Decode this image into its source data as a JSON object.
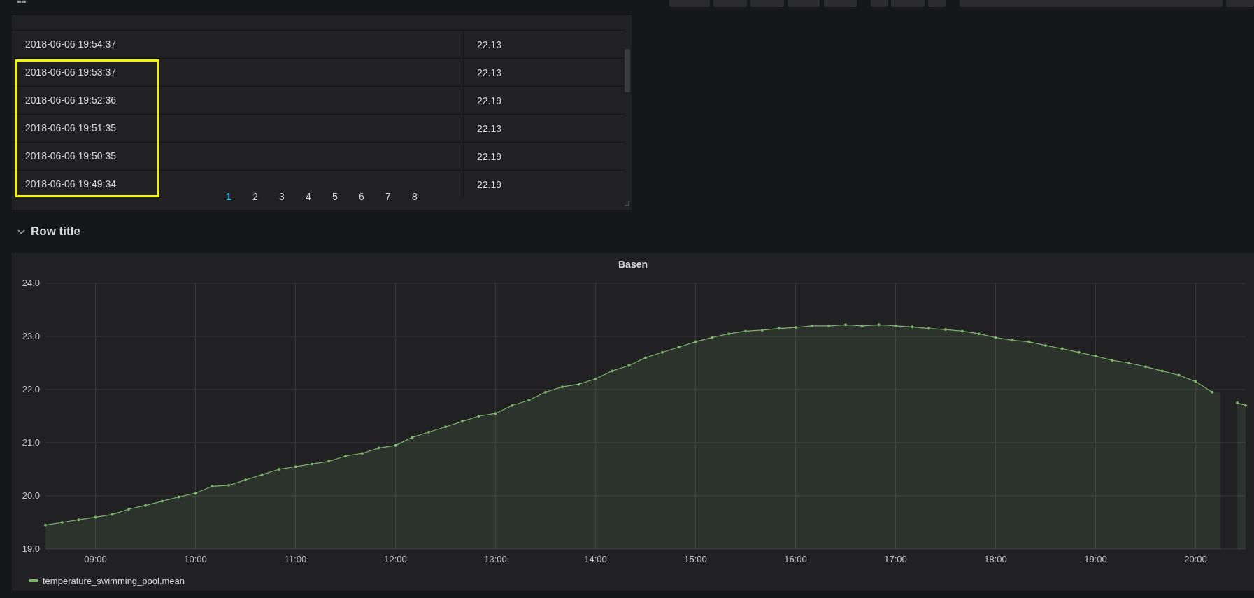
{
  "table": {
    "rows": [
      {
        "time": "2018-06-06 19:54:37",
        "value": "22.13",
        "highlighted": false
      },
      {
        "time": "2018-06-06 19:53:37",
        "value": "22.13",
        "highlighted": true
      },
      {
        "time": "2018-06-06 19:52:36",
        "value": "22.19",
        "highlighted": true
      },
      {
        "time": "2018-06-06 19:51:35",
        "value": "22.13",
        "highlighted": true
      },
      {
        "time": "2018-06-06 19:50:35",
        "value": "22.19",
        "highlighted": true
      },
      {
        "time": "2018-06-06 19:49:34",
        "value": "22.19",
        "highlighted": true
      }
    ],
    "pages": [
      {
        "label": "1",
        "selected": true
      },
      {
        "label": "2",
        "selected": false
      },
      {
        "label": "3",
        "selected": false
      },
      {
        "label": "4",
        "selected": false
      },
      {
        "label": "5",
        "selected": false
      },
      {
        "label": "6",
        "selected": false
      },
      {
        "label": "7",
        "selected": false
      },
      {
        "label": "8",
        "selected": false
      }
    ]
  },
  "row": {
    "title": "Row title",
    "expanded": true
  },
  "graph": {
    "title": "Basen",
    "chart_data": {
      "type": "area",
      "grid": true,
      "x": [
        510,
        520,
        530,
        540,
        550,
        560,
        570,
        580,
        590,
        600,
        610,
        620,
        630,
        640,
        650,
        660,
        670,
        680,
        690,
        700,
        710,
        720,
        730,
        740,
        750,
        760,
        770,
        780,
        790,
        800,
        810,
        820,
        830,
        840,
        850,
        860,
        870,
        880,
        890,
        900,
        910,
        920,
        930,
        940,
        950,
        960,
        970,
        980,
        990,
        1000,
        1010,
        1020,
        1030,
        1040,
        1050,
        1060,
        1070,
        1080,
        1090,
        1100,
        1110,
        1120,
        1130,
        1140,
        1150,
        1160,
        1170,
        1180,
        1190,
        1200,
        1210,
        1220,
        1225,
        1230
      ],
      "series": [
        {
          "name": "temperature_swimming_pool.mean",
          "color": "#7eb26d",
          "values": [
            19.45,
            19.5,
            19.55,
            19.6,
            19.65,
            19.75,
            19.82,
            19.9,
            19.98,
            20.05,
            20.18,
            20.2,
            20.3,
            20.4,
            20.5,
            20.55,
            20.6,
            20.65,
            20.75,
            20.8,
            20.9,
            20.95,
            21.1,
            21.2,
            21.3,
            21.4,
            21.5,
            21.55,
            21.7,
            21.8,
            21.95,
            22.05,
            22.1,
            22.2,
            22.35,
            22.45,
            22.6,
            22.7,
            22.8,
            22.9,
            22.98,
            23.05,
            23.1,
            23.12,
            23.15,
            23.17,
            23.2,
            23.2,
            23.22,
            23.2,
            23.22,
            23.2,
            23.18,
            23.15,
            23.13,
            23.1,
            23.05,
            22.98,
            22.93,
            22.9,
            22.83,
            22.77,
            22.7,
            22.63,
            22.55,
            22.5,
            22.43,
            22.35,
            22.27,
            22.15,
            21.95,
            null,
            21.75,
            21.7
          ]
        }
      ],
      "xlim": [
        510,
        1230
      ],
      "ylim": [
        19,
        24
      ],
      "xticks": [
        {
          "value": 540,
          "label": "09:00"
        },
        {
          "value": 600,
          "label": "10:00"
        },
        {
          "value": 660,
          "label": "11:00"
        },
        {
          "value": 720,
          "label": "12:00"
        },
        {
          "value": 780,
          "label": "13:00"
        },
        {
          "value": 840,
          "label": "14:00"
        },
        {
          "value": 900,
          "label": "15:00"
        },
        {
          "value": 960,
          "label": "16:00"
        },
        {
          "value": 1020,
          "label": "17:00"
        },
        {
          "value": 1080,
          "label": "18:00"
        },
        {
          "value": 1140,
          "label": "19:00"
        },
        {
          "value": 1200,
          "label": "20:00"
        }
      ],
      "yticks": [
        {
          "value": 19,
          "label": "19.0"
        },
        {
          "value": 20,
          "label": "20.0"
        },
        {
          "value": 21,
          "label": "21.0"
        },
        {
          "value": 22,
          "label": "22.0"
        },
        {
          "value": 23,
          "label": "23.0"
        },
        {
          "value": 24,
          "label": "24.0"
        }
      ]
    }
  }
}
